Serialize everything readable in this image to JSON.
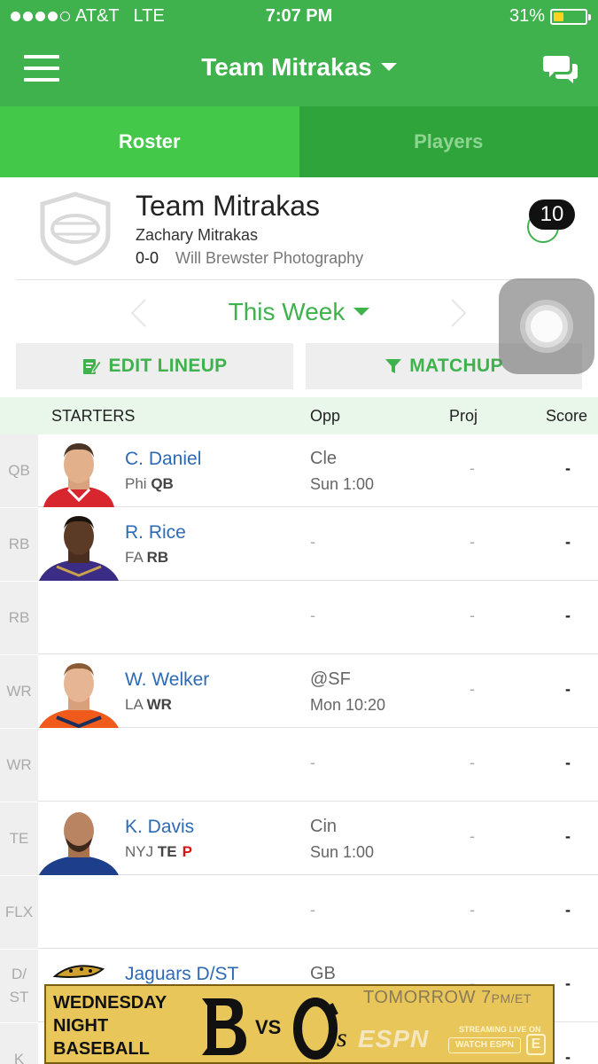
{
  "status_bar": {
    "carrier": "AT&T",
    "network": "LTE",
    "time": "7:07 PM",
    "battery_percent": "31%",
    "battery_level": 0.31,
    "battery_color": "#ffd21f"
  },
  "nav": {
    "menu_icon": "hamburger-menu-icon",
    "title": "Team Mitrakas",
    "chat_icon": "chat-bubbles-icon"
  },
  "tabs": [
    {
      "label": "Roster",
      "active": true
    },
    {
      "label": "Players",
      "active": false
    }
  ],
  "team": {
    "name": "Team Mitrakas",
    "owner": "Zachary Mitrakas",
    "record": "0-0",
    "league": "Will Brewster Photography",
    "notification_count": "10"
  },
  "week": {
    "label": "This Week"
  },
  "actions": {
    "edit_lineup": "EDIT LINEUP",
    "matchup": "MATCHUP"
  },
  "table": {
    "headers": {
      "starters": "STARTERS",
      "opp": "Opp",
      "proj": "Proj",
      "score": "Score"
    },
    "rows": [
      {
        "pos": "QB",
        "name": "C. Daniel",
        "team": "Phi",
        "player_pos": "QB",
        "injury": "",
        "opp": "Cle",
        "time": "Sun 1:00",
        "proj": "-",
        "score": "-",
        "jersey_color": "#d8262f"
      },
      {
        "pos": "RB",
        "name": "R. Rice",
        "team": "FA",
        "player_pos": "RB",
        "injury": "",
        "opp": "-",
        "time": "",
        "proj": "-",
        "score": "-",
        "jersey_color": "#3b2c86"
      },
      {
        "pos": "RB",
        "name": "",
        "team": "",
        "player_pos": "",
        "injury": "",
        "opp": "-",
        "time": "",
        "proj": "-",
        "score": "-",
        "jersey_color": ""
      },
      {
        "pos": "WR",
        "name": "W. Welker",
        "team": "LA",
        "player_pos": "WR",
        "injury": "",
        "opp": "@SF",
        "time": "Mon 10:20",
        "proj": "-",
        "score": "-",
        "jersey_color": "#f05a1a"
      },
      {
        "pos": "WR",
        "name": "",
        "team": "",
        "player_pos": "",
        "injury": "",
        "opp": "-",
        "time": "",
        "proj": "-",
        "score": "-",
        "jersey_color": ""
      },
      {
        "pos": "TE",
        "name": "K. Davis",
        "team": "NYJ",
        "player_pos": "TE",
        "injury": "P",
        "opp": "Cin",
        "time": "Sun 1:00",
        "proj": "-",
        "score": "-",
        "jersey_color": "#1d3e8a"
      },
      {
        "pos": "FLX",
        "name": "",
        "team": "",
        "player_pos": "",
        "injury": "",
        "opp": "-",
        "time": "",
        "proj": "-",
        "score": "-",
        "jersey_color": ""
      },
      {
        "pos": "D/\nST",
        "name": "Jaguars D/ST",
        "team": "",
        "player_pos": "",
        "injury": "",
        "opp": "GB",
        "time": "",
        "proj": "-",
        "score": "-",
        "jersey_color": ""
      },
      {
        "pos": "K",
        "name": "",
        "team": "",
        "player_pos": "",
        "injury": "",
        "opp": "",
        "time": "",
        "proj": "",
        "score": "-",
        "jersey_color": ""
      }
    ]
  },
  "ad": {
    "line1": "WEDNESDAY",
    "line2": "NIGHT",
    "line3": "BASEBALL",
    "when": "TOMORROW 7",
    "when_suffix": "PM/ET",
    "vs": "VS",
    "network": "ESPN",
    "streaming": "STREAMING LIVE ON",
    "watch": "WATCH ESPN"
  },
  "colors": {
    "brand_green": "#3fb24e",
    "tab_active": "#44c84a",
    "tab_inactive": "#2fa43b",
    "player_link": "#2e6ab3",
    "injury_red": "#d11111"
  }
}
